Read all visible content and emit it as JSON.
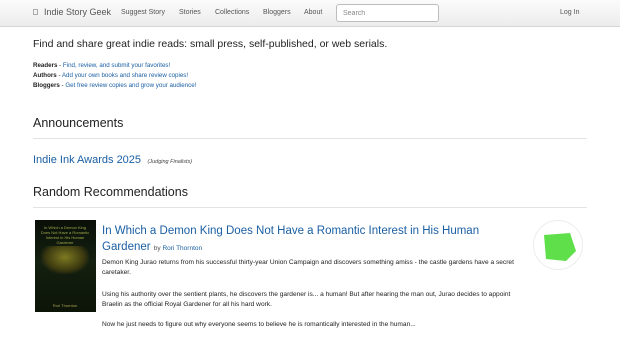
{
  "navbar": {
    "brand": "Indie Story Geek",
    "links": [
      "Suggest Story",
      "Stories",
      "Collections",
      "Bloggers",
      "About"
    ],
    "search_placeholder": "Search",
    "login": "Log In"
  },
  "intro": {
    "tagline": "Find and share great indie reads: small press, self-published, or web serials.",
    "roles": [
      {
        "role": "Readers",
        "text": "Find, review, and submit your favorites!"
      },
      {
        "role": "Authors",
        "text": "Add your own books and share review copies!"
      },
      {
        "role": "Bloggers",
        "text": "Get free review copies and grow your audience!"
      }
    ]
  },
  "announcements": {
    "heading": "Announcements",
    "item_link": "Indie Ink Awards 2025",
    "item_note": "(Judging Finalists)"
  },
  "recommendations": {
    "heading": "Random Recommendations",
    "book": {
      "title": "In Which a Demon King Does Not Have a Romantic Interest in His Human Gardener",
      "by": "by",
      "author": "Rori Thornton",
      "cover_title": "In Which a Demon King Does Not Have a Romantic Interest in His Human Gardener",
      "cover_author": "Rori Thornton",
      "paragraphs": [
        "Demon King Jurao returns from his successful thirty-year Union Campaign and discovers something amiss - the castle gardens have a secret caretaker.",
        "Using his authority over the sentient plants, he discovers the gardener is... a human! But after hearing the man out, Jurao decides to appoint Braelin as the official Royal Gardener for all his hard work.",
        "Now he just needs to figure out why everyone seems to believe he is romantically interested in the human..."
      ],
      "badge_color": "#5fe04a"
    }
  }
}
